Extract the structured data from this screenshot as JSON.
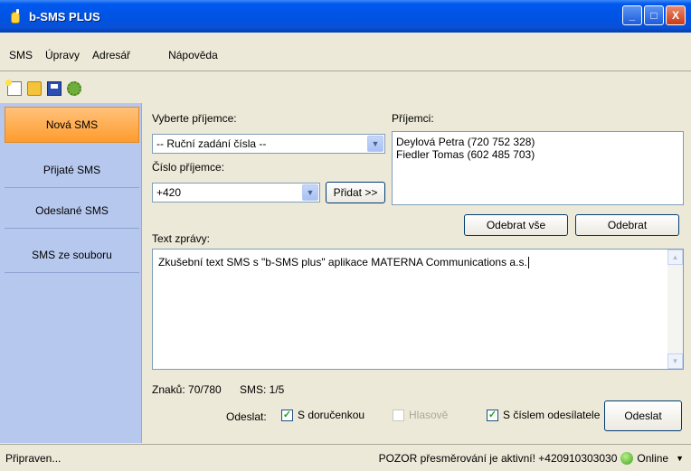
{
  "window": {
    "title": "b-SMS PLUS",
    "min_glyph": "_",
    "max_glyph": "□",
    "close_glyph": "X"
  },
  "menu": {
    "items": [
      "SMS",
      "Úpravy",
      "Adresář",
      "Nápověda"
    ]
  },
  "sidebar": {
    "items": [
      {
        "label": "Nová SMS",
        "active": true
      },
      {
        "label": "Přijaté SMS",
        "active": false
      },
      {
        "label": "Odeslané SMS",
        "active": false
      },
      {
        "label": "SMS ze souboru",
        "active": false
      }
    ]
  },
  "recipient_select": {
    "label": "Vyberte příjemce:",
    "value": "-- Ruční zadání čísla --"
  },
  "number": {
    "label": "Číslo příjemce:",
    "value": "+420"
  },
  "add_button": "Přidat >>",
  "recipients": {
    "label": "Příjemci:",
    "items": [
      "Deylová Petra (720 752 328)",
      "Fiedler Tomas (602 485 703)"
    ]
  },
  "remove_all_button": "Odebrat vše",
  "remove_button": "Odebrat",
  "message": {
    "label": "Text zprávy:",
    "value": "Zkušební text SMS s \"b-SMS plus\" aplikace MATERNA Communications a.s."
  },
  "counters": {
    "chars": "Znaků: 70/780",
    "sms": "SMS: 1/5"
  },
  "send": {
    "label": "Odeslat:",
    "delivery_report": {
      "label": "S doručenkou",
      "checked": true
    },
    "voice": {
      "label": "Hlasově",
      "checked": false,
      "disabled": true
    },
    "sender_number": {
      "label": "S číslem odesílatele",
      "checked": true
    },
    "button": "Odeslat"
  },
  "status": {
    "left": "Připraven...",
    "warning": "POZOR přesměrování je aktivní! +420910303030",
    "online": "Online"
  }
}
